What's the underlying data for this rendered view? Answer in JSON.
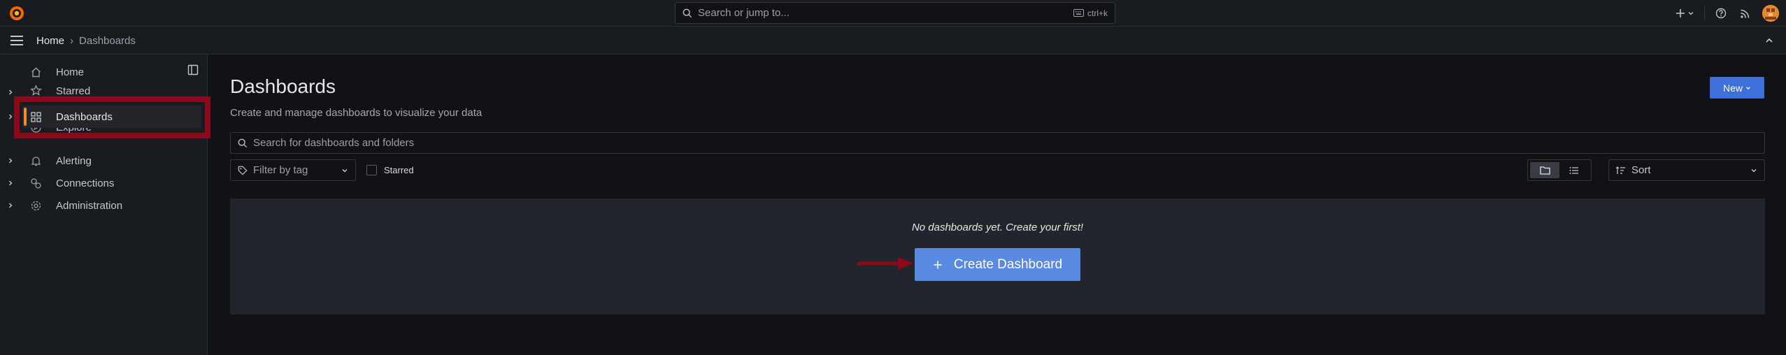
{
  "topbar": {
    "search": {
      "placeholder": "Search or jump to...",
      "shortcut": "ctrl+k"
    },
    "icons": [
      "grafana-logo-icon",
      "search-icon",
      "keyboard-icon",
      "plus-icon",
      "chevron-down-icon",
      "help-icon",
      "rss-icon",
      "avatar"
    ]
  },
  "breadcrumb": {
    "home": "Home",
    "separator": "›",
    "current": "Dashboards"
  },
  "sidebar": {
    "items": [
      {
        "label": "Home",
        "icon": "home-icon",
        "expandable": false
      },
      {
        "label": "Starred",
        "icon": "star-icon",
        "expandable": true
      },
      {
        "label": "Dashboards",
        "icon": "apps-icon",
        "expandable": true,
        "active": true
      },
      {
        "label": "Explore",
        "icon": "compass-icon",
        "expandable": false
      },
      {
        "label": "Alerting",
        "icon": "bell-icon",
        "expandable": true
      },
      {
        "label": "Connections",
        "icon": "connections-icon",
        "expandable": true
      },
      {
        "label": "Administration",
        "icon": "cog-icon",
        "expandable": true
      }
    ]
  },
  "main": {
    "title": "Dashboards",
    "subtitle": "Create and manage dashboards to visualize your data",
    "new_button": "New",
    "search_placeholder": "Search for dashboards and folders",
    "tag_filter_placeholder": "Filter by tag",
    "starred_label": "Starred",
    "sort_label": "Sort",
    "empty_message": "No dashboards yet. Create your first!",
    "create_button": "Create Dashboard"
  },
  "colors": {
    "accent_orange": "#f58a2e",
    "primary_blue": "#3d71d9",
    "create_blue": "#5a8ae0",
    "annotation_red": "#8c0a1a",
    "background": "#111217",
    "panel": "#181b1f"
  }
}
